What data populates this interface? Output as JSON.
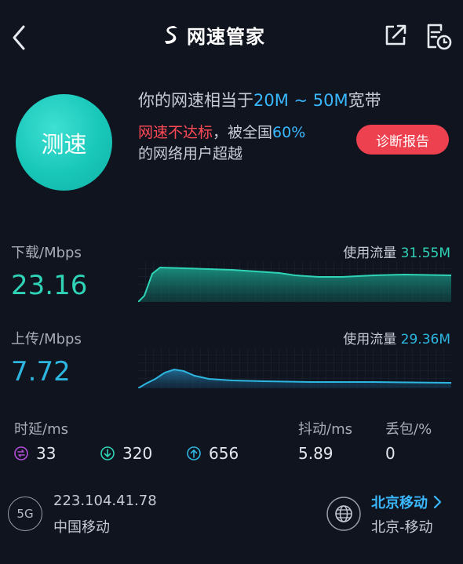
{
  "header": {
    "title": "网速管家",
    "icons": {
      "back": "back-chevron-icon",
      "share": "share-export-icon",
      "history": "history-record-icon",
      "logo": "speed-logo-icon"
    }
  },
  "summary": {
    "prefix": "你的网速相当于",
    "range": "20M ~ 50M",
    "suffix": "宽带",
    "warning": "网速不达标",
    "beaten_prefix": "，被全国",
    "percent": "60%",
    "beaten_suffix": "的网络用户超越",
    "speed_button": "测速",
    "report_button": "诊断报告"
  },
  "download": {
    "label": "下载/Mbps",
    "value": "23.16",
    "usage_label": "使用流量",
    "usage_value": "31.55M",
    "color": "#2fd3b6"
  },
  "upload": {
    "label": "上传/Mbps",
    "value": "7.72",
    "usage_label": "使用流量",
    "usage_value": "29.36M",
    "color": "#2db6e0"
  },
  "stats": {
    "latency_label": "时延/ms",
    "latency_idle": "33",
    "latency_down": "320",
    "latency_up": "656",
    "jitter_label": "抖动/ms",
    "jitter_value": "5.89",
    "loss_label": "丢包/%",
    "loss_value": "0"
  },
  "network": {
    "type": "5G",
    "ip": "223.104.41.78",
    "isp": "中国移动",
    "server_name": "北京移动",
    "server_sub": "北京-移动"
  },
  "colors": {
    "background": "#10141f",
    "accent_teal": "#1ec5b7",
    "accent_blue": "#3ab8ff",
    "alert_red": "#ee4150"
  }
}
